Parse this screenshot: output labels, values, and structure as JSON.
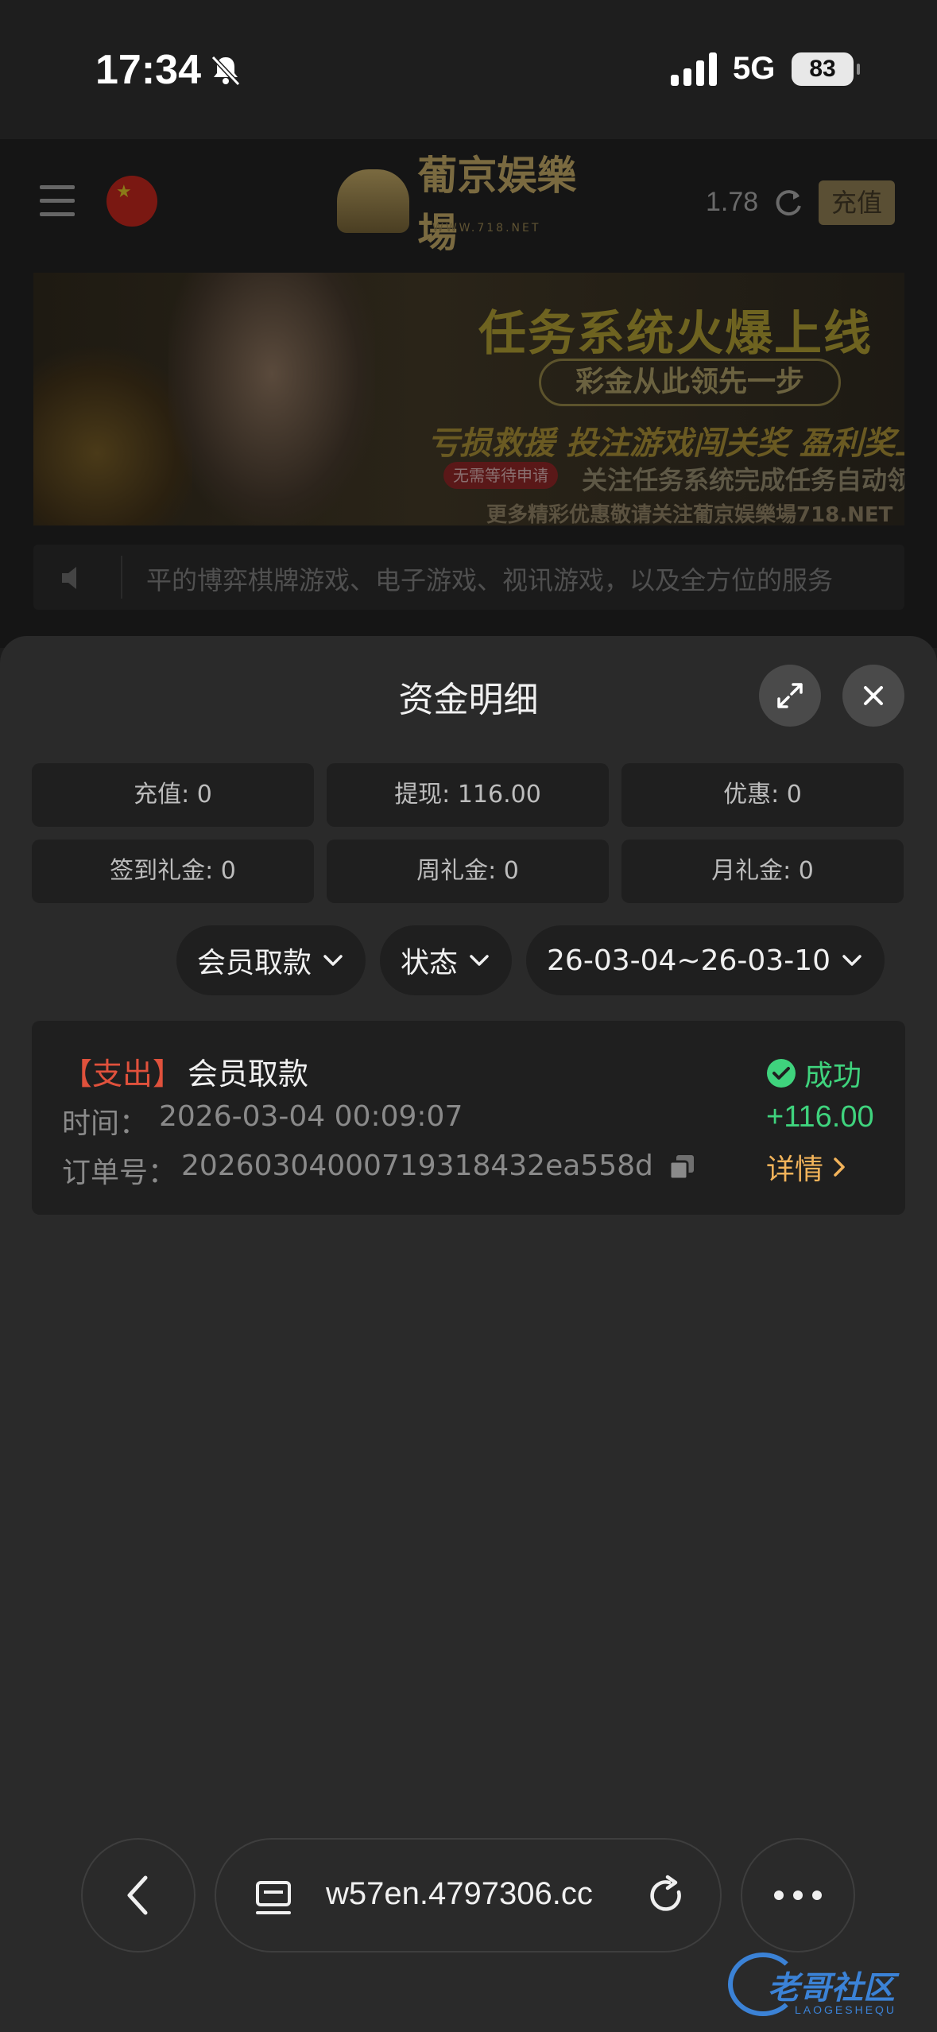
{
  "status_bar": {
    "time": "17:34",
    "network": "5G",
    "battery": "83",
    "icons": [
      "bell-muted-icon",
      "signal-icon"
    ]
  },
  "background_page": {
    "logo_text": "葡京娱樂場",
    "logo_sub": "WWW.718.NET",
    "balance": "1.78",
    "recharge_label": "充值",
    "banner": {
      "title": "任务系统火爆上线",
      "pill": "彩金从此领先一步",
      "line3": "亏损救援 投注游戏闯关奖 盈利奖上",
      "tag": "无需等待申请",
      "line4": "关注任务系统完成任务自动领",
      "line5": "更多精彩优惠敬请关注葡京娱樂場718.NET"
    },
    "marquee_text": "平的博弈棋牌游戏、电子游戏、视讯游戏，以及全方位的服务"
  },
  "sheet": {
    "title": "资金明细",
    "stats": [
      {
        "label": "充值: 0"
      },
      {
        "label": "提现: 116.00"
      },
      {
        "label": "优惠: 0"
      },
      {
        "label": "签到礼金: 0"
      },
      {
        "label": "周礼金: 0"
      },
      {
        "label": "月礼金: 0"
      }
    ],
    "filters": {
      "type": "会员取款",
      "status": "状态",
      "date_range": "26-03-04~26-03-10"
    },
    "records": [
      {
        "type": "【支出】",
        "name": "会员取款",
        "time_label": "时间：",
        "time": "2026-03-04 00:09:07",
        "order_label": "订单号：",
        "order": "20260304000719318432ea558d",
        "status": "成功",
        "amount": "+116.00",
        "detail": "详情"
      }
    ]
  },
  "browser": {
    "url": "w57en.4797306.cc"
  },
  "watermark": {
    "text": "老哥社区",
    "sub": "LAOGESHEQU"
  },
  "colors": {
    "expense": "#e0513c",
    "success": "#3fd37d",
    "detail": "#f2b35a",
    "sheet_bg": "#2a2a2a",
    "cell_bg": "#1f1f1f"
  }
}
